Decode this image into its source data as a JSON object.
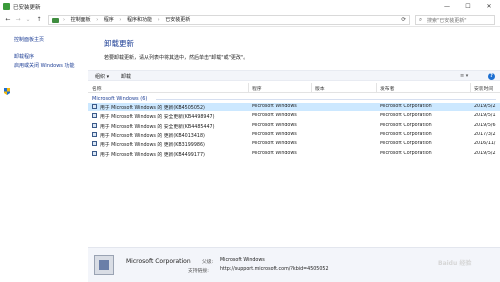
{
  "window": {
    "title": "已安装更新",
    "controls": {
      "minimize": "—",
      "maximize": "☐",
      "close": "✕"
    }
  },
  "address": {
    "breadcrumbs": [
      "控制面板",
      "程序",
      "程序和功能",
      "已安装更新"
    ],
    "separator": "›",
    "search_placeholder": "搜索\"已安装更新\""
  },
  "sidebar": {
    "links": [
      "控制面板主页",
      "卸载程序",
      "启用或关闭 Windows 功能"
    ]
  },
  "main": {
    "title": "卸载更新",
    "description": "若要卸载更新，请从列表中将其选中，然后单击\"卸载\"或\"更改\"。"
  },
  "toolbar": {
    "organize_label": "组织 ▾",
    "uninstall_label": "卸载",
    "view_icon": "≡ ▾",
    "help_icon": "?"
  },
  "columns": [
    "名称",
    "程序",
    "版本",
    "发布者",
    "安装时间"
  ],
  "group": {
    "label": "Microsoft Windows (6)"
  },
  "rows": [
    {
      "name": "用于 Microsoft Windows 的 更新(KB4505052)",
      "program": "Microsoft Windows",
      "version": "",
      "publisher": "Microsoft Corporation",
      "installed": "2019/5/2",
      "selected": true
    },
    {
      "name": "用于 Microsoft Windows 的 安全更新(KB4498947)",
      "program": "Microsoft Windows",
      "version": "",
      "publisher": "Microsoft Corporation",
      "installed": "2019/5/1",
      "selected": false
    },
    {
      "name": "用于 Microsoft Windows 的 安全更新(KB4485447)",
      "program": "Microsoft Windows",
      "version": "",
      "publisher": "Microsoft Corporation",
      "installed": "2019/5/6",
      "selected": false
    },
    {
      "name": "用于 Microsoft Windows 的 更新(KB4013418)",
      "program": "Microsoft Windows",
      "version": "",
      "publisher": "Microsoft Corporation",
      "installed": "2017/3/2",
      "selected": false
    },
    {
      "name": "用于 Microsoft Windows 的 更新(KB3199986)",
      "program": "Microsoft Windows",
      "version": "",
      "publisher": "Microsoft Corporation",
      "installed": "2016/11/",
      "selected": false
    },
    {
      "name": "用于 Microsoft Windows 的 更新(KB4499177)",
      "program": "Microsoft Windows",
      "version": "",
      "publisher": "Microsoft Corporation",
      "installed": "2019/5/2",
      "selected": false
    }
  ],
  "details": {
    "publisher": "Microsoft Corporation",
    "parent_label": "父级:",
    "parent_value": "Microsoft Windows",
    "support_label": "支持链接:",
    "support_value": "http://support.microsoft.com/?kbid=4505052"
  },
  "watermark": "Baidu 经验",
  "colors": {
    "link": "#1e3f96",
    "selection": "#cce8ff",
    "toolbar_bg": "#f3f5fa"
  }
}
